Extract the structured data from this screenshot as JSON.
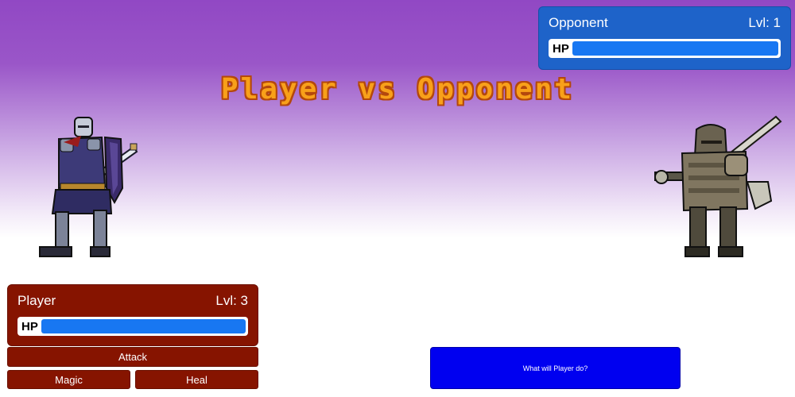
{
  "title": "Player vs Opponent",
  "opponent": {
    "name": "Opponent",
    "level": "Lvl: 1",
    "hp_label": "HP",
    "hp_fraction": 1.0
  },
  "player": {
    "name": "Player",
    "level": "Lvl: 3",
    "hp_label": "HP",
    "hp_fraction": 1.0
  },
  "actions": {
    "attack": "Attack",
    "magic": "Magic",
    "heal": "Heal"
  },
  "prompt": "What will Player do?",
  "colors": {
    "player_panel": "#861400",
    "opponent_panel": "#1e63c9",
    "hp_bar": "#1877f2",
    "prompt_panel": "#0000f0",
    "title": "#f8a01a"
  },
  "sprites": {
    "player": "knight-sprite",
    "opponent": "armored-knight-sprite"
  }
}
